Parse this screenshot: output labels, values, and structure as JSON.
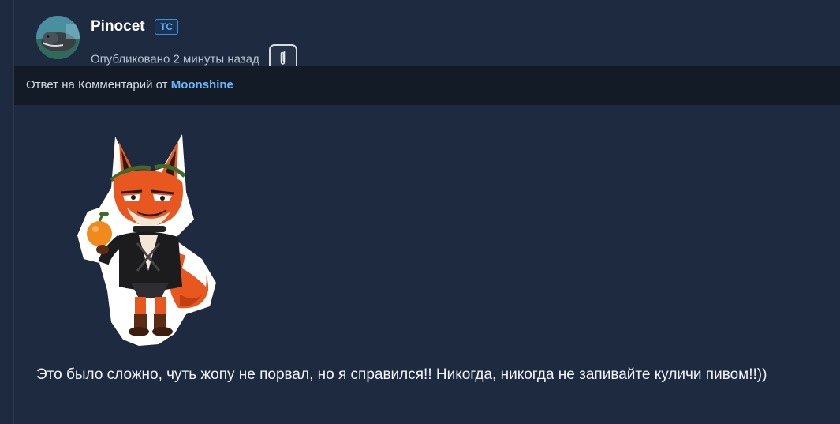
{
  "post": {
    "author": "Pinocet",
    "badge": "ТС",
    "published": "Опубликовано 2 минуты назад",
    "attachment_icon": "paperclip-icon"
  },
  "reply": {
    "prefix": "Ответ на Комментарий от",
    "target_author": "Moonshine"
  },
  "sticker": {
    "icon": "fox-sticker"
  },
  "comment": {
    "text": "Это было сложно, чуть жопу не порвал, но я справился!! Никогда, никогда не запивайте куличи пивом!!))"
  },
  "colors": {
    "background": "#1e2a3f",
    "reply_bar": "#131b27",
    "accent_link": "#6ab8ff",
    "badge_border": "#3d8ed9"
  }
}
